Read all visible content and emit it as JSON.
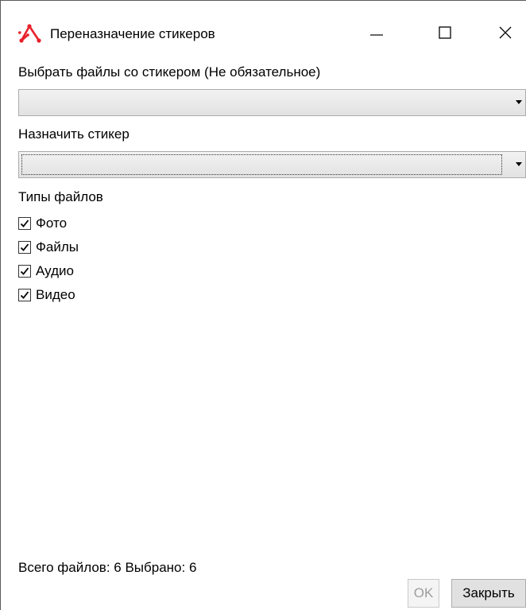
{
  "window": {
    "title": "Переназначение стикеров",
    "controls": {
      "minimize": "minimize",
      "maximize": "maximize",
      "close": "close"
    }
  },
  "filter_sticker": {
    "label": "Выбрать файлы со стикером (Не обязательное)",
    "value": ""
  },
  "assign_sticker": {
    "label": "Назначить стикер",
    "value": ""
  },
  "file_types": {
    "label": "Типы файлов",
    "items": [
      {
        "label": "Фото",
        "checked": true
      },
      {
        "label": "Файлы",
        "checked": true
      },
      {
        "label": "Аудио",
        "checked": true
      },
      {
        "label": "Видео",
        "checked": true
      }
    ]
  },
  "status": {
    "text": "Всего файлов: 6 Выбрано: 6"
  },
  "buttons": {
    "ok": "OK",
    "close": "Закрыть"
  },
  "colors": {
    "accent": "#e8202a",
    "text": "#000000",
    "disabled": "#9d9d9d"
  }
}
